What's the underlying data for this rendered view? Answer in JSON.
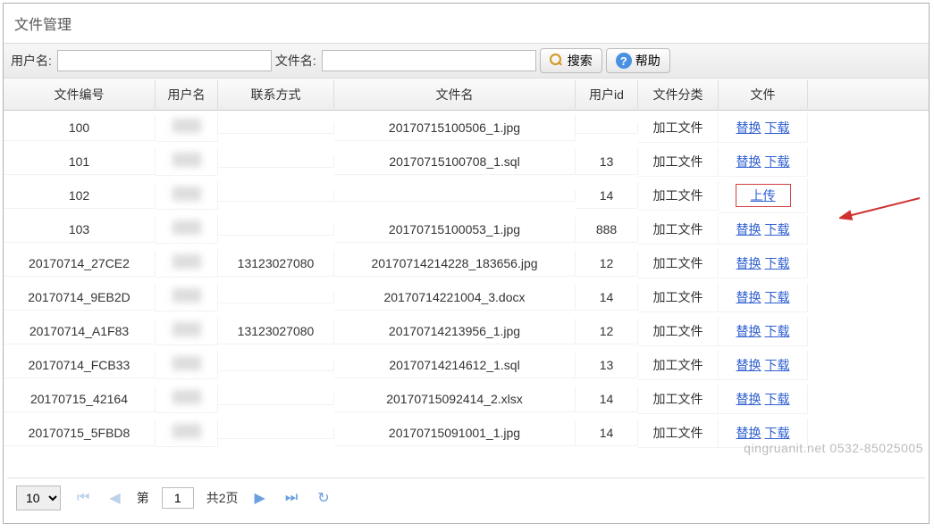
{
  "panel": {
    "title": "文件管理"
  },
  "toolbar": {
    "user_label": "用户名:",
    "file_label": "文件名:",
    "search_label": "搜索",
    "help_label": "帮助"
  },
  "columns": {
    "id": "文件编号",
    "user": "用户名",
    "contact": "联系方式",
    "filename": "文件名",
    "uid": "用户id",
    "category": "文件分类",
    "file": "文件"
  },
  "rows": [
    {
      "id": "100",
      "contact": "",
      "filename": "20170715100506_1.jpg",
      "uid": "",
      "category": "加工文件",
      "actions": [
        "替换",
        "下载"
      ]
    },
    {
      "id": "101",
      "contact": "",
      "filename": "20170715100708_1.sql",
      "uid": "13",
      "category": "加工文件",
      "actions": [
        "替换",
        "下载"
      ]
    },
    {
      "id": "102",
      "contact": "",
      "filename": "",
      "uid": "14",
      "category": "加工文件",
      "actions": [
        "上传"
      ],
      "highlight": true
    },
    {
      "id": "103",
      "contact": "",
      "filename": "20170715100053_1.jpg",
      "uid": "888",
      "category": "加工文件",
      "actions": [
        "替换",
        "下载"
      ]
    },
    {
      "id": "20170714_27CE2",
      "contact": "13123027080",
      "filename": "20170714214228_183656.jpg",
      "uid": "12",
      "category": "加工文件",
      "actions": [
        "替换",
        "下载"
      ]
    },
    {
      "id": "20170714_9EB2D",
      "contact": "",
      "filename": "20170714221004_3.docx",
      "uid": "14",
      "category": "加工文件",
      "actions": [
        "替换",
        "下载"
      ]
    },
    {
      "id": "20170714_A1F83",
      "contact": "13123027080",
      "filename": "20170714213956_1.jpg",
      "uid": "12",
      "category": "加工文件",
      "actions": [
        "替换",
        "下载"
      ]
    },
    {
      "id": "20170714_FCB33",
      "contact": "",
      "filename": "20170714214612_1.sql",
      "uid": "13",
      "category": "加工文件",
      "actions": [
        "替换",
        "下载"
      ]
    },
    {
      "id": "20170715_42164",
      "contact": "",
      "filename": "20170715092414_2.xlsx",
      "uid": "14",
      "category": "加工文件",
      "actions": [
        "替换",
        "下载"
      ]
    },
    {
      "id": "20170715_5FBD8",
      "contact": "",
      "filename": "20170715091001_1.jpg",
      "uid": "14",
      "category": "加工文件",
      "actions": [
        "替换",
        "下载"
      ]
    }
  ],
  "pager": {
    "page_size": "10",
    "prefix": "第",
    "current": "1",
    "total_label": "共2页"
  },
  "watermark": "qingruanit.net 0532-85025005"
}
